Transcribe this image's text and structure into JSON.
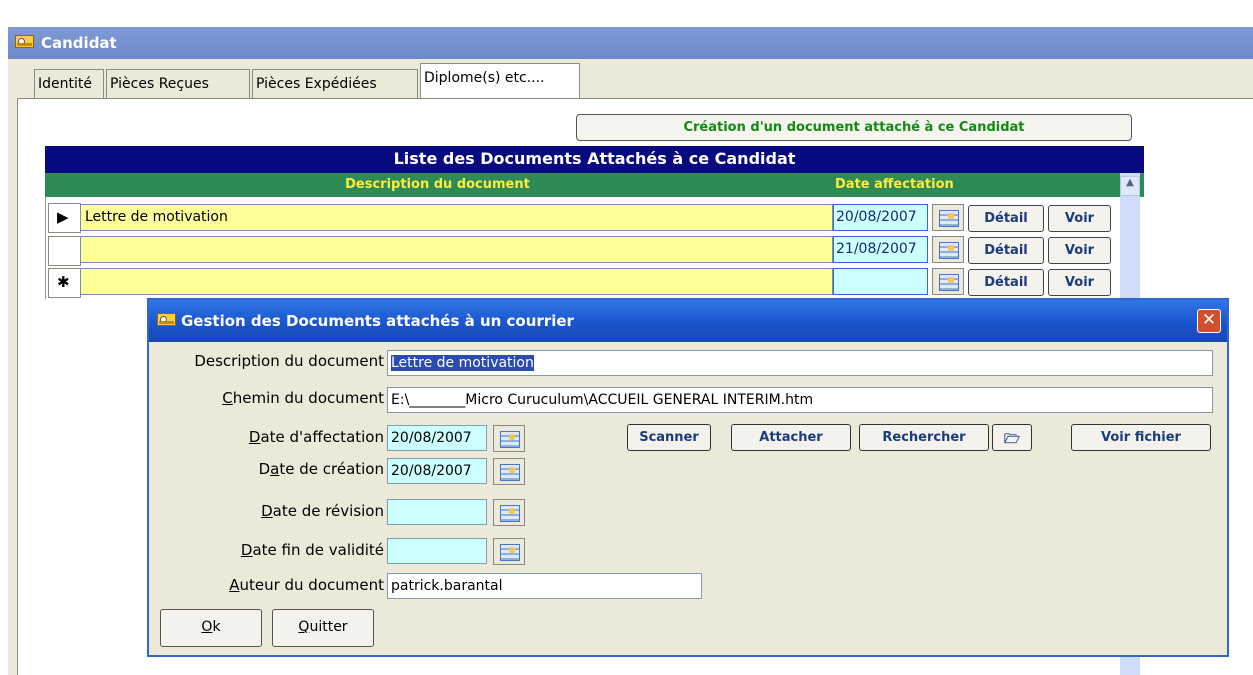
{
  "window": {
    "title": "Candidat"
  },
  "tabs": [
    {
      "label": "Identité"
    },
    {
      "label": "Pièces Reçues"
    },
    {
      "label": "Pièces Expédiées"
    },
    {
      "label": "Diplome(s) etc...."
    }
  ],
  "create_button": "Création d'un document attaché à ce Candidat",
  "list": {
    "header": "Liste  des Documents Attachés à ce Candidat",
    "columns": [
      "Description du document",
      "Date affectation"
    ],
    "rows": [
      {
        "selector": "▶",
        "description": "Lettre de motivation",
        "date": "20/08/2007"
      },
      {
        "selector": "",
        "description": "",
        "date": "21/08/2007"
      },
      {
        "selector": "✱",
        "description": "",
        "date": ""
      }
    ],
    "detail_label": "Détail",
    "voir_label": "Voir"
  },
  "dialog": {
    "title": "Gestion des Documents attachés à un courrier",
    "close": "✕",
    "description_label": "Description du document",
    "description_value": "Lettre de motivation",
    "chemin_label": "Chemin du document",
    "chemin_value": "E:\\________Micro Curuculum\\ACCUEIL GENERAL INTERIM.htm",
    "date_affectation_label": "Date d'affectation",
    "date_affectation_value": "20/08/2007",
    "date_creation_label": "Date de création",
    "date_creation_value": "20/08/2007",
    "date_revision_label": "Date de révision",
    "date_revision_value": "",
    "date_fin_label": "Date fin de validité",
    "date_fin_value": "",
    "auteur_label": "Auteur du document",
    "auteur_value": "patrick.barantal",
    "buttons": {
      "scanner": "Scanner",
      "attacher": "Attacher",
      "rechercher": "Rechercher",
      "voir_fichier": "Voir fichier",
      "ok": "Ok",
      "quitter": "Quitter"
    }
  }
}
